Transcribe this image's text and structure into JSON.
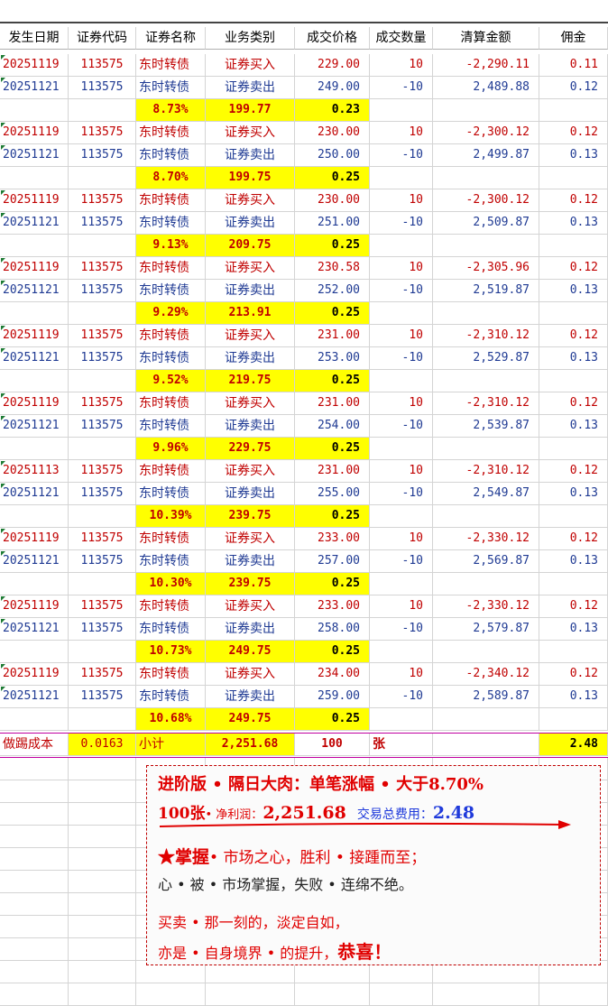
{
  "columns": [
    "发生日期",
    "证券代码",
    "证券名称",
    "业务类别",
    "成交价格",
    "成交数量",
    "清算金额",
    "佣金"
  ],
  "groups": [
    {
      "buy": [
        "20251119",
        "113575",
        "东时转债",
        "证券买入",
        "229.00",
        "10",
        "-2,290.11",
        "0.11"
      ],
      "sell": [
        "20251121",
        "113575",
        "东时转债",
        "证券卖出",
        "249.00",
        "-10",
        "2,489.88",
        "0.12"
      ],
      "summary": [
        "8.73%",
        "199.77",
        "0.23"
      ]
    },
    {
      "buy": [
        "20251119",
        "113575",
        "东时转债",
        "证券买入",
        "230.00",
        "10",
        "-2,300.12",
        "0.12"
      ],
      "sell": [
        "20251121",
        "113575",
        "东时转债",
        "证券卖出",
        "250.00",
        "-10",
        "2,499.87",
        "0.13"
      ],
      "summary": [
        "8.70%",
        "199.75",
        "0.25"
      ]
    },
    {
      "buy": [
        "20251119",
        "113575",
        "东时转债",
        "证券买入",
        "230.00",
        "10",
        "-2,300.12",
        "0.12"
      ],
      "sell": [
        "20251121",
        "113575",
        "东时转债",
        "证券卖出",
        "251.00",
        "-10",
        "2,509.87",
        "0.13"
      ],
      "summary": [
        "9.13%",
        "209.75",
        "0.25"
      ]
    },
    {
      "buy": [
        "20251119",
        "113575",
        "东时转债",
        "证券买入",
        "230.58",
        "10",
        "-2,305.96",
        "0.12"
      ],
      "sell": [
        "20251121",
        "113575",
        "东时转债",
        "证券卖出",
        "252.00",
        "-10",
        "2,519.87",
        "0.13"
      ],
      "summary": [
        "9.29%",
        "213.91",
        "0.25"
      ]
    },
    {
      "buy": [
        "20251119",
        "113575",
        "东时转债",
        "证券买入",
        "231.00",
        "10",
        "-2,310.12",
        "0.12"
      ],
      "sell": [
        "20251121",
        "113575",
        "东时转债",
        "证券卖出",
        "253.00",
        "-10",
        "2,529.87",
        "0.13"
      ],
      "summary": [
        "9.52%",
        "219.75",
        "0.25"
      ]
    },
    {
      "buy": [
        "20251119",
        "113575",
        "东时转债",
        "证券买入",
        "231.00",
        "10",
        "-2,310.12",
        "0.12"
      ],
      "sell": [
        "20251121",
        "113575",
        "东时转债",
        "证券卖出",
        "254.00",
        "-10",
        "2,539.87",
        "0.13"
      ],
      "summary": [
        "9.96%",
        "229.75",
        "0.25"
      ]
    },
    {
      "buy": [
        "20251113",
        "113575",
        "东时转债",
        "证券买入",
        "231.00",
        "10",
        "-2,310.12",
        "0.12"
      ],
      "sell": [
        "20251121",
        "113575",
        "东时转债",
        "证券卖出",
        "255.00",
        "-10",
        "2,549.87",
        "0.13"
      ],
      "summary": [
        "10.39%",
        "239.75",
        "0.25"
      ]
    },
    {
      "buy": [
        "20251119",
        "113575",
        "东时转债",
        "证券买入",
        "233.00",
        "10",
        "-2,330.12",
        "0.12"
      ],
      "sell": [
        "20251121",
        "113575",
        "东时转债",
        "证券卖出",
        "257.00",
        "-10",
        "2,569.87",
        "0.13"
      ],
      "summary": [
        "10.30%",
        "239.75",
        "0.25"
      ]
    },
    {
      "buy": [
        "20251119",
        "113575",
        "东时转债",
        "证券买入",
        "233.00",
        "10",
        "-2,330.12",
        "0.12"
      ],
      "sell": [
        "20251121",
        "113575",
        "东时转债",
        "证券卖出",
        "258.00",
        "-10",
        "2,579.87",
        "0.13"
      ],
      "summary": [
        "10.73%",
        "249.75",
        "0.25"
      ]
    },
    {
      "buy": [
        "20251119",
        "113575",
        "东时转债",
        "证券买入",
        "234.00",
        "10",
        "-2,340.12",
        "0.12"
      ],
      "sell": [
        "20251121",
        "113575",
        "东时转债",
        "证券卖出",
        "259.00",
        "-10",
        "2,589.87",
        "0.13"
      ],
      "summary": [
        "10.68%",
        "249.75",
        "0.25"
      ]
    }
  ],
  "totals": {
    "label": "做踢成本",
    "cost": "0.0163",
    "subtotal_label": "小计",
    "profit": "2,251.68",
    "quantity": "100",
    "unit": "张",
    "commission": "2.48"
  },
  "card": {
    "line1": "进阶版 • 隔日大肉：单笔涨幅 • 大于8.70%",
    "line2_qty": "100张",
    "line2_profit_label": "• 净利润：",
    "line2_profit": "2,251.68",
    "line2_fee_label": "交易总费用：",
    "line2_fee": "2.48",
    "line3_star": "★掌握",
    "line3_rest": "• 市场之心，胜利 • 接踵而至；",
    "line4": "心 • 被 • 市场掌握，失败 • 连绵不绝。",
    "line5": "买卖 • 那一刻的，淡定自如，",
    "line6_a": "亦是 • 自身境界 • 的提升，",
    "line6_b": "恭喜！"
  },
  "colors": {
    "buy": "#c00000",
    "sell": "#1f3a93",
    "highlight": "#ffff00",
    "accent_red": "#e00000",
    "accent_blue": "#1f3adb"
  }
}
